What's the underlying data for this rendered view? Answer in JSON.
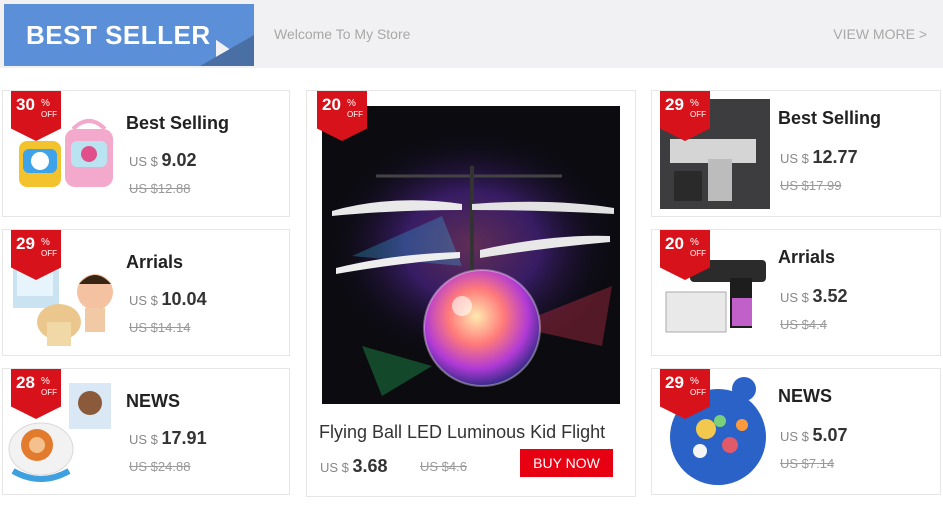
{
  "header": {
    "badge_text": "BEST SELLER",
    "welcome": "Welcome To My Store",
    "view_more": "VIEW MORE >"
  },
  "discount_pct_symbol": "%",
  "discount_off": "OFF",
  "currency": "US $",
  "products_left": [
    {
      "discount": "30",
      "title": "Best Selling",
      "price": "9.02",
      "old_price": "US $12.88"
    },
    {
      "discount": "29",
      "title": "Arrials",
      "price": "10.04",
      "old_price": "US $14.14"
    },
    {
      "discount": "28",
      "title": "NEWS",
      "price": "17.91",
      "old_price": "US $24.88"
    }
  ],
  "featured": {
    "discount": "20",
    "title": "Flying Ball LED Luminous Kid Flight",
    "price": "3.68",
    "old_price": "US $4.6",
    "buy_label": "BUY NOW"
  },
  "products_right": [
    {
      "discount": "29",
      "title": "Best Selling",
      "price": "12.77",
      "old_price": "US $17.99"
    },
    {
      "discount": "20",
      "title": "Arrials",
      "price": "3.52",
      "old_price": "US $4.4"
    },
    {
      "discount": "29",
      "title": "NEWS",
      "price": "5.07",
      "old_price": "US $7.14"
    }
  ],
  "colors": {
    "accent_red": "#d8121b",
    "brand_blue": "#5b8fd8"
  }
}
